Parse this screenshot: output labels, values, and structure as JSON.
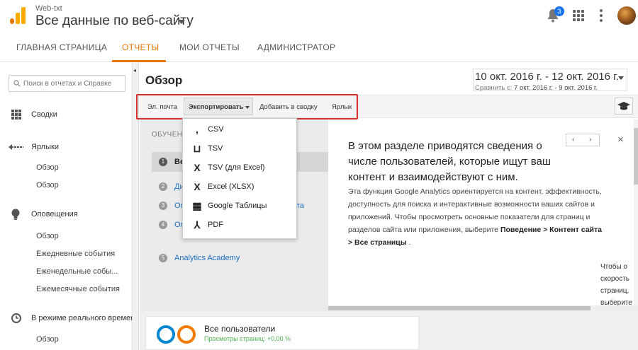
{
  "header": {
    "account": "Web-txt",
    "property": "Все данные по веб-сайту",
    "notification_count": "3"
  },
  "nav": {
    "tabs": [
      "ГЛАВНАЯ СТРАНИЦА",
      "ОТЧЕТЫ",
      "МОИ ОТЧЕТЫ",
      "АДМИНИСТРАТОР"
    ],
    "active": "ОТЧЕТЫ"
  },
  "sidebar": {
    "search_placeholder": "Поиск в отчетах и Справке",
    "sections": [
      {
        "label": "Сводки",
        "icon": "dashboard-grid-icon"
      },
      {
        "label": "Ярлыки",
        "icon": "shortcut-arrow-icon",
        "items": [
          "Обзор",
          "Обзор"
        ]
      },
      {
        "label": "Оповещения",
        "icon": "lightbulb-icon",
        "items": [
          "Обзор",
          "Ежедневные события",
          "Еженедельные собы...",
          "Ежемесячные события"
        ]
      },
      {
        "label": "В режиме реального времен",
        "icon": "clock-icon",
        "items": [
          "Обзор"
        ]
      }
    ]
  },
  "main": {
    "title": "Обзор",
    "date_range": "10 окт. 2016 г. - 12 окт. 2016 г.",
    "compare_prefix": "Сравнить с:",
    "compare_range": "7 окт. 2016 г. - 9 окт. 2016 г."
  },
  "toolbar": {
    "email": "Эл. почта",
    "export": "Экспортировать",
    "add_dashboard": "Добавить в сводку",
    "shortcut": "Ярлык"
  },
  "export_menu": {
    "items": [
      {
        "label": "CSV",
        "icon": "csv-icon",
        "glyph": ","
      },
      {
        "label": "TSV",
        "icon": "tsv-icon",
        "glyph": "⊔"
      },
      {
        "label": "TSV (для Excel)",
        "icon": "excel-icon",
        "glyph": "X"
      },
      {
        "label": "Excel (XLSX)",
        "icon": "excel-icon",
        "glyph": "X"
      },
      {
        "label": "Google Таблицы",
        "icon": "sheets-icon",
        "glyph": "▦"
      },
      {
        "label": "PDF",
        "icon": "pdf-icon",
        "glyph": "⅄"
      }
    ]
  },
  "onboarding": {
    "heading": "ОБУЧЕНИ",
    "steps": [
      {
        "num": "1",
        "label": "Ве"
      },
      {
        "num": "2",
        "label": "Ди"
      },
      {
        "num": "3",
        "label": "Ог"
      },
      {
        "num": "4",
        "label": "Ог"
      },
      {
        "num": "5",
        "label": "Analytics Academy"
      }
    ],
    "steps_partial": {
      "step3_tail": "та"
    },
    "title": "В этом разделе приводятся сведения о числе пользователей, которые ищут ваш контент и взаимодействуют с ним.",
    "body_text": "Эта функция Google Analytics ориентируется на контент, эффективность, доступность для поиска и интерактивные возможности ваших сайтов и приложений. Чтобы просмотреть основные показатели для страниц и разделов сайта или приложения, выберите",
    "body_bold": "Поведение > Контент сайта > Все страницы",
    "body_end": " .",
    "overflow_lines": [
      "Чтобы о",
      "скорость",
      "страниц,",
      "выберите"
    ]
  },
  "card": {
    "title": "Все пользователи",
    "subtitle": "Просмотры страниц: +0,00 %"
  }
}
